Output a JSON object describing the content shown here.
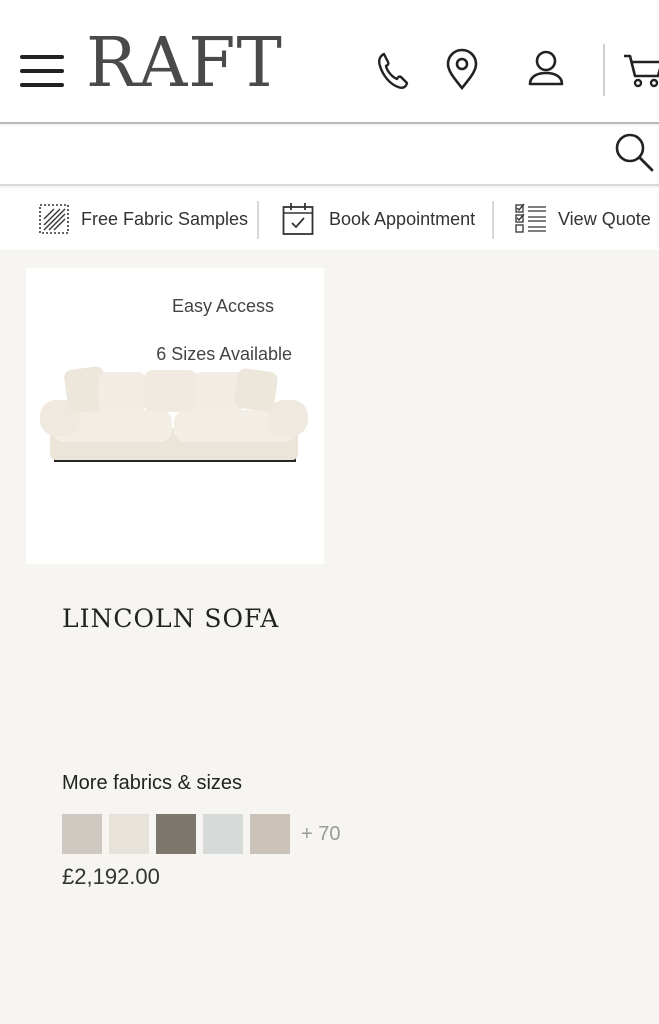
{
  "header": {
    "logo": "RAFT",
    "icons": [
      "menu-icon",
      "phone-icon",
      "location-pin-icon",
      "user-icon",
      "cart-icon"
    ]
  },
  "search": {
    "value": "",
    "placeholder": ""
  },
  "utility": {
    "fabric_samples": "Free Fabric Samples",
    "book_appointment": "Book Appointment",
    "view_quote": "View Quote"
  },
  "product": {
    "badges": [
      "Easy Access",
      "6 Sizes Available"
    ],
    "name": "LINCOLN SOFA",
    "more_label": "More fabrics & sizes",
    "swatch_colors": [
      "#cfc8c0",
      "#e8e3da",
      "#7c766d",
      "#d6dbda",
      "#cbc3ba"
    ],
    "more_count": "+ 70",
    "price": "£2,192.00"
  },
  "colors": {
    "background": "#f6f5f2",
    "logo": "#4a4a4a",
    "sofa": "#efe9df"
  }
}
